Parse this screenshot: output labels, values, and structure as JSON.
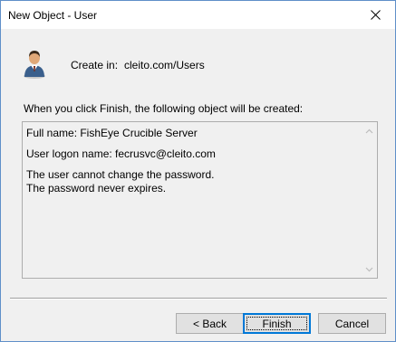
{
  "window": {
    "title": "New Object - User",
    "close_icon": "close-icon"
  },
  "header": {
    "icon": "user-icon",
    "create_label": "Create in:",
    "create_value": "cleito.com/Users"
  },
  "intro": "When you click Finish, the following object will be created:",
  "summary": {
    "lines": [
      "Full name: FishEye Crucible Server",
      "User logon name: fecrusvc@cleito.com",
      "The user cannot change the password.",
      "The password never expires."
    ]
  },
  "buttons": {
    "back": "< Back",
    "finish": "Finish",
    "cancel": "Cancel"
  },
  "colors": {
    "accent": "#0078d7",
    "window_border": "#5f8fc9",
    "background": "#f0f0f0"
  }
}
